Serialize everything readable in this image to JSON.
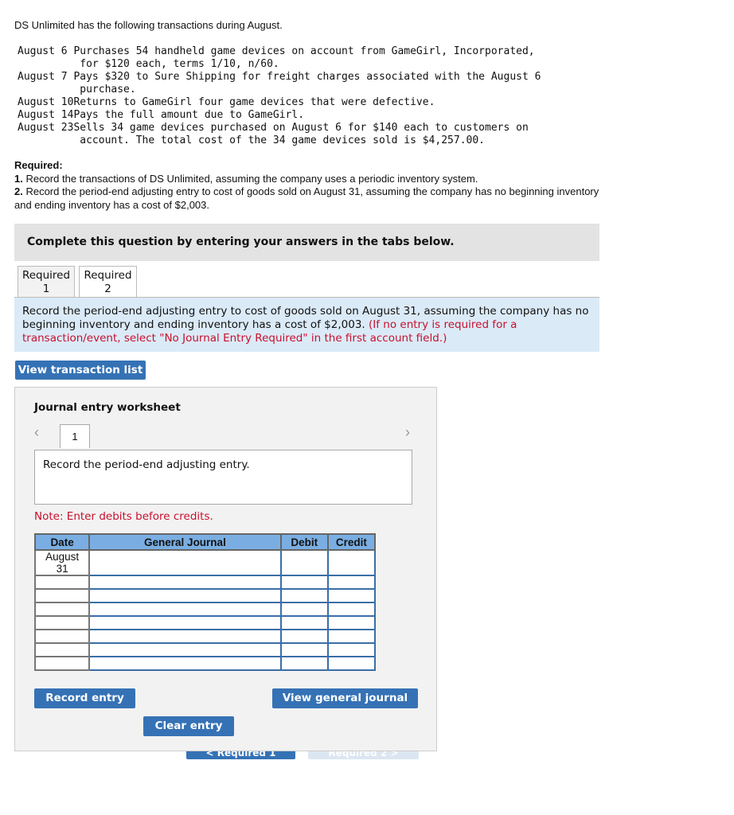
{
  "intro": "DS Unlimited has the following transactions during August.",
  "transactions": [
    {
      "date": "August 6 ",
      "text": "Purchases 54 handheld game devices on account from GameGirl, Incorporated,\n          for $120 each, terms 1/10, n/60."
    },
    {
      "date": "August 7 ",
      "text": "Pays $320 to Sure Shipping for freight charges associated with the August 6\n          purchase."
    },
    {
      "date": "August 10",
      "text": "Returns to GameGirl four game devices that were defective."
    },
    {
      "date": "August 14",
      "text": "Pays the full amount due to GameGirl."
    },
    {
      "date": "August 23",
      "text": "Sells 34 game devices purchased on August 6 for $140 each to customers on\n          account. The total cost of the 34 game devices sold is $4,257.00."
    }
  ],
  "required": {
    "title": "Required:",
    "item1_num": "1.",
    "item1": " Record the transactions of DS Unlimited, assuming the company uses a periodic inventory system.",
    "item2_num": "2.",
    "item2": " Record the period-end adjusting entry to cost of goods sold on August 31, assuming the company has no beginning inventory and ending inventory has a cost of $2,003."
  },
  "banner": "Complete this question by entering your answers in the tabs below.",
  "tabs": [
    {
      "line1": "Required",
      "line2": "1"
    },
    {
      "line1": "Required",
      "line2": "2",
      "active": true
    }
  ],
  "instruction": "Record the period-end adjusting entry to cost of goods sold on August 31, assuming the company has no beginning inventory and ending inventory has a cost of $2,003.",
  "instruction_red": " (If no entry is required for a transaction/event, select \"No Journal Entry Required\" in the first account field.)",
  "view_transaction_list": "View transaction list",
  "worksheet": {
    "title": "Journal entry worksheet",
    "page": "1",
    "prompt": "Record the period-end adjusting entry.",
    "note": "Note: Enter debits before credits.",
    "headers": [
      "Date",
      "General Journal",
      "Debit",
      "Credit"
    ],
    "first_date": "August\n31",
    "record": "Record entry",
    "clear": "Clear entry",
    "view_journal": "View general journal"
  },
  "nav": {
    "prev": "< Required 1",
    "next": "Required 2 >"
  },
  "colors": {
    "button": "#3572b5",
    "header": "#7aaee2",
    "red": "#c8102e"
  }
}
